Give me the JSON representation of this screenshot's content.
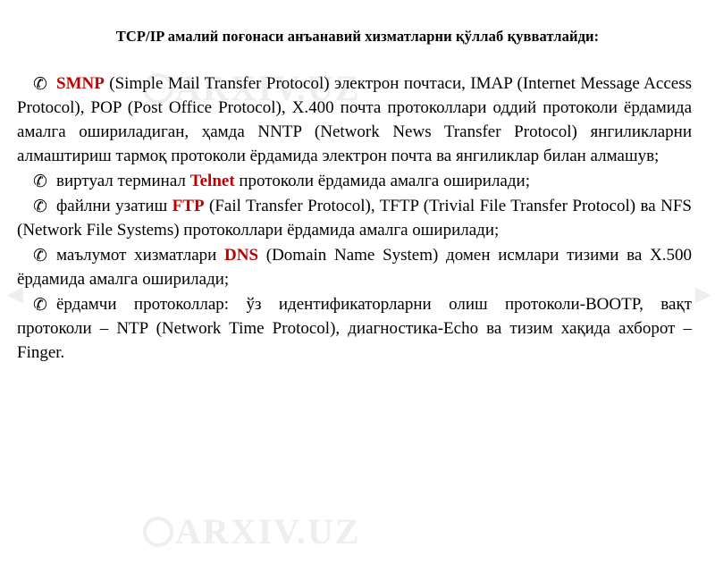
{
  "document": {
    "title": "TCP/IP амалий поғонаси анъанавий хизматларни қўллаб қувватлайди:",
    "bullet_glyph": "✆",
    "paragraphs": [
      {
        "accent": "SMNP",
        "text_after": " (Simple Mail Transfer Protocol) электрон почтаси, IMAP (Internet Message Access Protocol), POP (Post Office Protocol), X.400 почта протоколлари оддий протоколи ёрдамида амалга ошириладиган, ҳамда NNTP (Network News Transfer Protocol) янгиликларни алмаштириш тармоқ протоколи ёрдамида электрон почта ва янгиликлар билан алмашув;"
      },
      {
        "text_before": "виртуал терминал ",
        "accent": "Telnet",
        "text_after": " протоколи ёрдамида амалга оширилади;"
      },
      {
        "text_before": "файлни узатиш ",
        "accent": "FTP",
        "text_after": " (Fail Transfer Protocol), TFTP (Trivial File Transfer Protocol) ва NFS (Network File Systems) протоколлари ёрдамида амалга оширилади;"
      },
      {
        "text_before": "маълумот хизматлари ",
        "accent": "DNS",
        "text_after": " (Domain Name System) домен исмлари тизими ва X.500 ёрдамида амалга оширилади;"
      },
      {
        "text_before": "ёрдамчи протоколлар: ўз идентификаторларни олиш протоколи-BOOTP, вақт протоколи – NTP (Network Time Protocol), диагностика-Echo ва тизим хақида ахборот –Finger.",
        "accent": "",
        "text_after": ""
      }
    ]
  },
  "watermark": {
    "text": "ARXIV.UZ"
  },
  "colors": {
    "accent": "#c00000",
    "watermark": "#eeeeee",
    "text": "#000000",
    "background": "#ffffff"
  }
}
